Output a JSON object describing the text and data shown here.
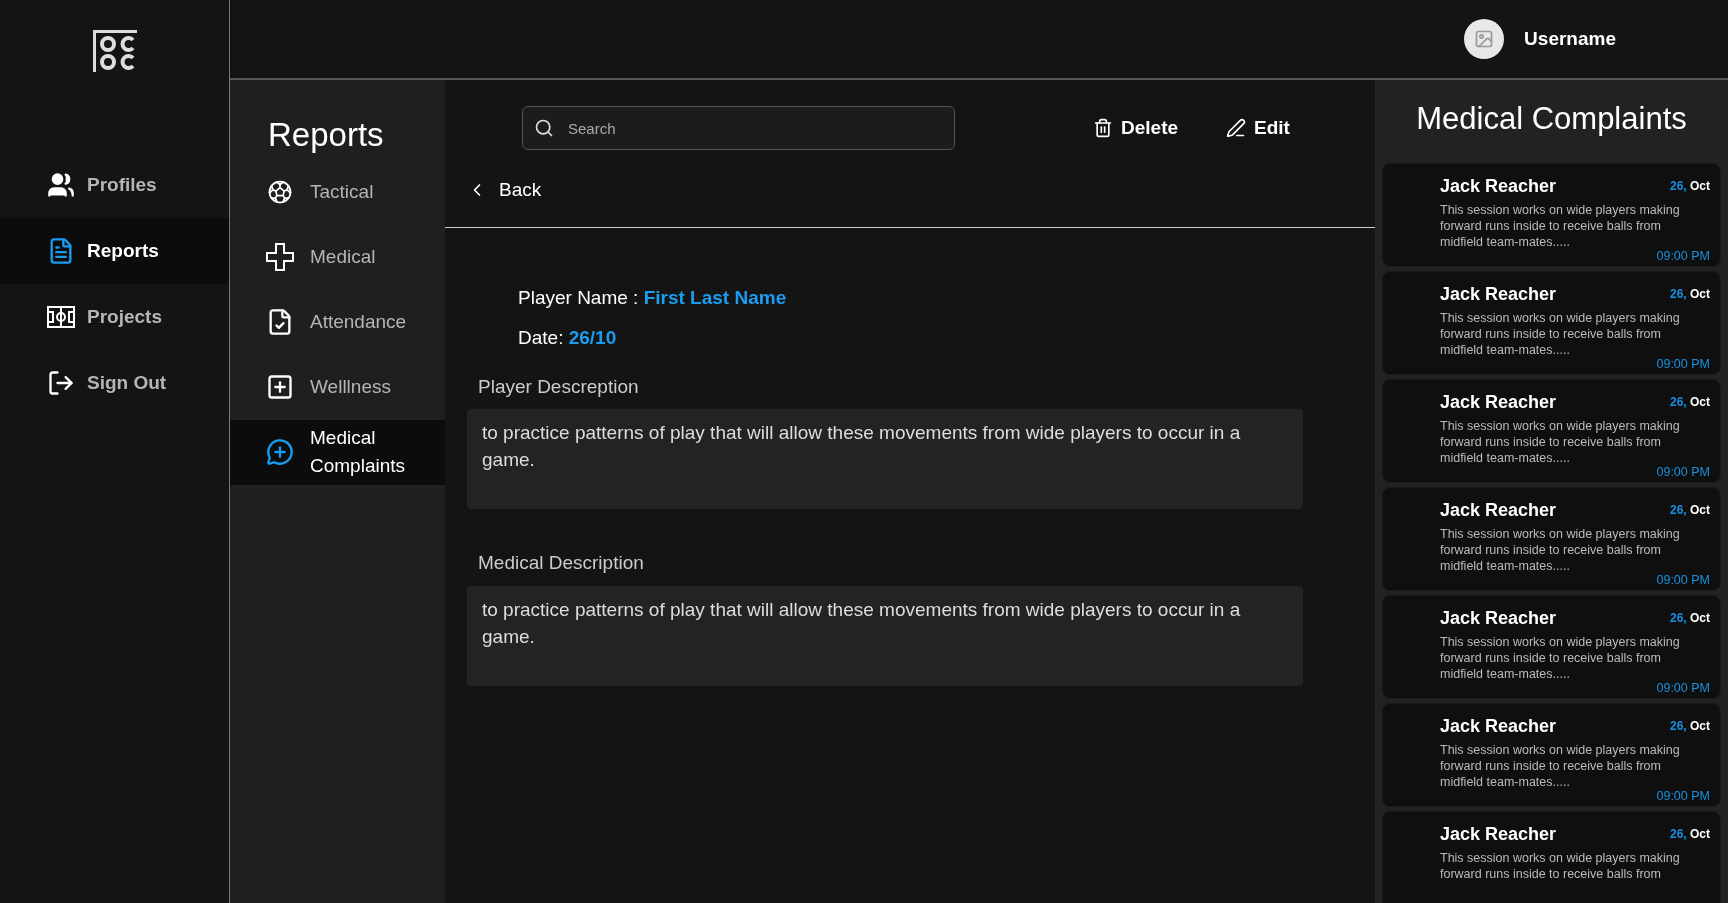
{
  "user": {
    "name": "Username"
  },
  "sidebar": {
    "items": [
      {
        "label": "Profiles",
        "kind": "profiles",
        "selected": false
      },
      {
        "label": "Reports",
        "kind": "reports",
        "selected": true
      },
      {
        "label": "Projects",
        "kind": "projects",
        "selected": false
      },
      {
        "label": "Sign Out",
        "kind": "signout",
        "selected": false
      }
    ]
  },
  "submenu": {
    "title": "Reports",
    "items": [
      {
        "label": "Tactical",
        "kind": "tactical",
        "selected": false
      },
      {
        "label": "Medical",
        "kind": "medical",
        "selected": false
      },
      {
        "label": "Attendance",
        "kind": "attendance",
        "selected": false
      },
      {
        "label": "Welllness",
        "kind": "wellness",
        "selected": false
      },
      {
        "label": "Medical Complaints",
        "kind": "complaints",
        "selected": true
      }
    ]
  },
  "toolbar": {
    "search": {
      "placeholder": "Search"
    },
    "actions": [
      {
        "label": "Delete",
        "kind": "delete"
      },
      {
        "label": "Edit",
        "kind": "edit"
      }
    ]
  },
  "back": "Back",
  "details": [
    {
      "label": "Player Name :",
      "value": "First Last Name"
    },
    {
      "label": "Date:",
      "value": "26/10"
    }
  ],
  "sections": [
    {
      "label": "Player Descreption",
      "text": "to practice patterns of play that will allow these movements from  wide players to occur in a game."
    },
    {
      "label": "Medical Description",
      "text": "to practice patterns of play that will allow these movements from  wide players to occur in a game."
    }
  ],
  "complaints": {
    "title": "Medical Complaints",
    "cards": [
      {
        "name": "Jack Reacher",
        "day": "26,",
        "month": "Oct",
        "description": "This session works on wide players making forward runs inside to receive balls from midfield team-mates.....",
        "time": "09:00 PM"
      },
      {
        "name": "Jack Reacher",
        "day": "26,",
        "month": "Oct",
        "description": "This session works on wide players making forward runs inside to receive balls from midfield team-mates.....",
        "time": "09:00 PM"
      },
      {
        "name": "Jack Reacher",
        "day": "26,",
        "month": "Oct",
        "description": "This session works on wide players making forward runs inside to receive balls from midfield team-mates.....",
        "time": "09:00 PM"
      },
      {
        "name": "Jack Reacher",
        "day": "26,",
        "month": "Oct",
        "description": "This session works on wide players making forward runs inside to receive balls from midfield team-mates.....",
        "time": "09:00 PM"
      },
      {
        "name": "Jack Reacher",
        "day": "26,",
        "month": "Oct",
        "description": "This session works on wide players making forward runs inside to receive balls from midfield team-mates.....",
        "time": "09:00 PM"
      },
      {
        "name": "Jack Reacher",
        "day": "26,",
        "month": "Oct",
        "description": "This session works on wide players making forward runs inside to receive balls from midfield team-mates.....",
        "time": "09:00 PM"
      },
      {
        "name": "Jack Reacher",
        "day": "26,",
        "month": "Oct",
        "description": "This session works on wide players making forward runs inside to receive balls from"
      }
    ]
  }
}
